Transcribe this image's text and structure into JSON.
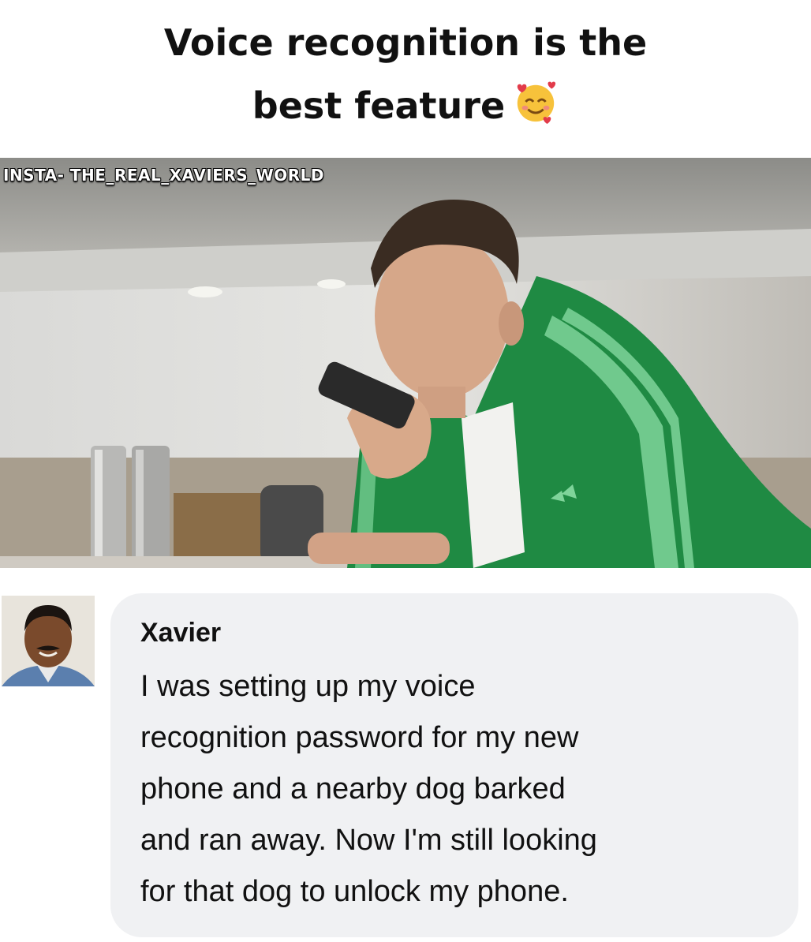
{
  "post": {
    "title_lines": [
      "Voice recognition is the",
      "best feature"
    ],
    "title_emoji": "smiling-face-with-hearts-icon",
    "watermark": "INSTA- THE_REAL_XAVIERS_WORLD"
  },
  "comment": {
    "author": "Xavier",
    "lines": [
      "I was setting up my voice",
      "recognition password for my new",
      "phone and a nearby dog barked",
      "and ran away. Now I'm still looking",
      "for that dog to unlock my phone."
    ]
  },
  "colors": {
    "jacket_green": "#1f8a43",
    "stripe_green": "#7fd49a",
    "comment_bg": "#f0f1f3"
  }
}
